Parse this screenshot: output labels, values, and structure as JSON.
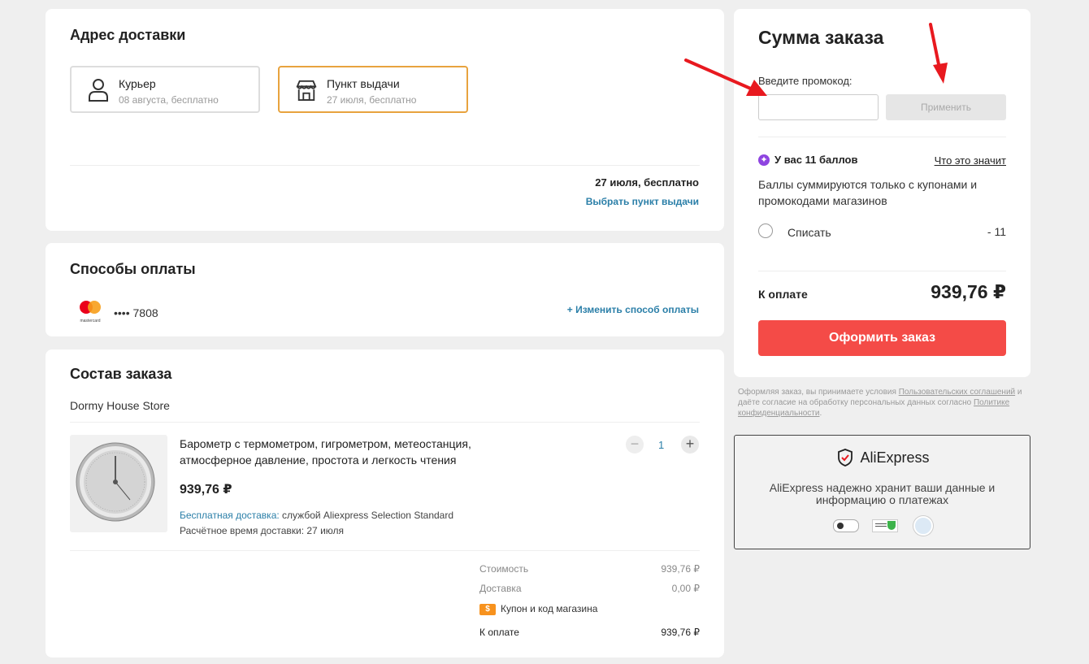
{
  "delivery": {
    "title": "Адрес доставки",
    "options": [
      {
        "label": "Курьер",
        "sub": "08 августа, бесплатно"
      },
      {
        "label": "Пункт выдачи",
        "sub": "27 июля, бесплатно"
      }
    ],
    "selected_date": "27 июля, бесплатно",
    "choose_link": "Выбрать пункт выдачи"
  },
  "payment": {
    "title": "Способы оплаты",
    "card_brand_text": "mastercard",
    "card_number": "•••• 7808",
    "change_link": "+ Изменить способ оплаты"
  },
  "order": {
    "title": "Состав заказа",
    "store": "Dormy House Store",
    "item": {
      "name_line1": "Барометр с термометром, гигрометром, метеостанция,",
      "name_line2": "атмосферное давление, простота и легкость чтения",
      "price": "939,76 ₽",
      "shipping_label": "Бесплатная доставка:",
      "shipping_value": "службой Aliexpress Selection Standard",
      "eta": "Расчётное время доставки: 27 июля",
      "quantity": "1",
      "minus": "−",
      "plus": "+"
    },
    "summary": {
      "cost_label": "Стоимость",
      "cost_value": "939,76 ₽",
      "delivery_label": "Доставка",
      "delivery_value": "0,00 ₽",
      "coupon_label": "Купон и код магазина",
      "coupon_icon_text": "$",
      "total_label": "К оплате",
      "total_value": "939,76 ₽"
    }
  },
  "sidebar": {
    "title": "Сумма заказа",
    "promo_label": "Введите промокод:",
    "promo_value": "",
    "apply": "Применить",
    "points_title": "У вас 11 баллов",
    "points_link": "Что это значит",
    "points_desc_line1": "Баллы суммируются только с купонами и",
    "points_desc_line2": "промокодами магазинов",
    "writeoff_label": "Списать",
    "writeoff_value": "- 11",
    "total_label": "К оплате",
    "total_value": "939,76 ₽",
    "checkout": "Оформить заказ"
  },
  "legal": {
    "t1": "Оформляя заказ, вы принимаете условия ",
    "link1": "Пользовательских соглашений",
    "t2": " и даёте согласие на обработку персональных данных согласно ",
    "link2": "Политике конфиденциальности",
    "t3": "."
  },
  "trust": {
    "brand": "AliExpress",
    "line1": "AliExpress надежно хранит ваши данные и",
    "line2": "информацию о платежах"
  },
  "colors": {
    "accent": "#f44b47",
    "selected_border": "#e8a33e",
    "link": "#2b7fa8",
    "annotation_arrow": "#e8191f"
  }
}
